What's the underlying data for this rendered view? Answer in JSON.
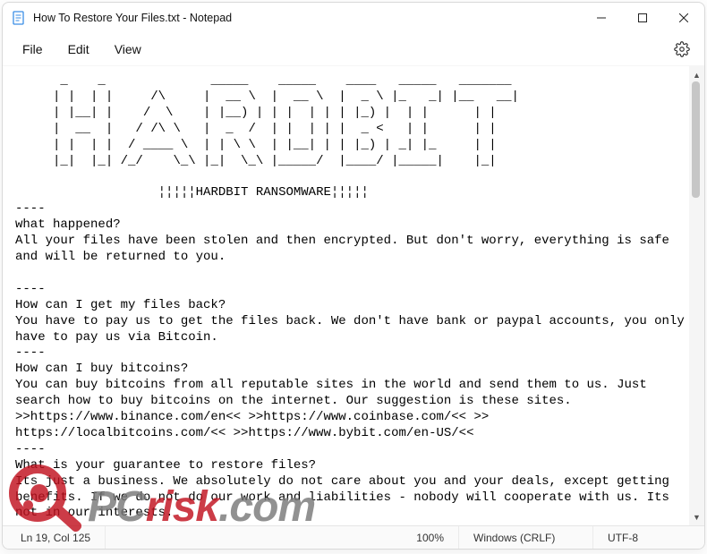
{
  "titlebar": {
    "title": "How To Restore Your Files.txt - Notepad"
  },
  "menubar": {
    "file": "File",
    "edit": "Edit",
    "view": "View"
  },
  "document": {
    "text": "      _    _              _____    _____    ____   _____   _______ \n     | |  | |     /\\     |  __ \\  |  __ \\  |  _ \\ |_   _| |__   __|\n     | |__| |    /  \\    | |__) | | |  | | | |_) |  | |      | |\n     |  __  |   / /\\ \\   |  _  /  | |  | | |  _ <   | |      | |\n     | |  | |  / ____ \\  | | \\ \\  | |__| | | |_) | _| |_     | |\n     |_|  |_| /_/    \\_\\ |_|  \\_\\ |_____/  |____/ |_____|    |_|\n\n                   ¦¦¦¦¦HARDBIT RANSOMWARE¦¦¦¦¦\n----\nwhat happened?\nAll your files have been stolen and then encrypted. But don't worry, everything is safe and will be returned to you.\n\n----\nHow can I get my files back?\nYou have to pay us to get the files back. We don't have bank or paypal accounts, you only have to pay us via Bitcoin.\n----\nHow can I buy bitcoins?\nYou can buy bitcoins from all reputable sites in the world and send them to us. Just search how to buy bitcoins on the internet. Our suggestion is these sites.\n>>https://www.binance.com/en<< >>https://www.coinbase.com/<< >>\nhttps://localbitcoins.com/<< >>https://www.bybit.com/en-US/<<\n----\nWhat is your guarantee to restore files?\nIts just a business. We absolutely do not care about you and your deals, except getting benefits. If we do not do our work and liabilities - nobody will cooperate with us. Its not in our interests."
  },
  "statusbar": {
    "cursor": "Ln 19, Col 125",
    "zoom": "100%",
    "eol": "Windows (CRLF)",
    "encoding": "UTF-8"
  },
  "watermark": {
    "pc": "PC",
    "risk": "risk",
    "com": ".com"
  }
}
